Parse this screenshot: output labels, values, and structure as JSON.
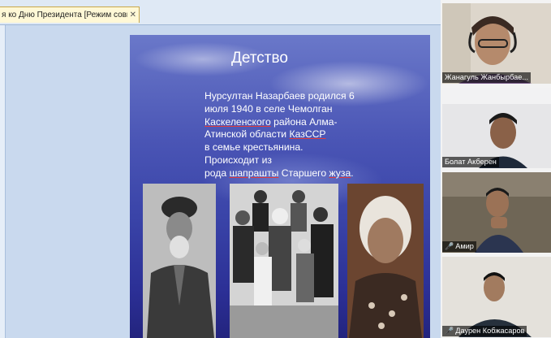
{
  "editor": {
    "doc_tab_title": "я ко Дню Президента [Режим совместимости]",
    "doc_tab_close": "✕"
  },
  "slide": {
    "title": "Детство",
    "body": {
      "line1": "Нурсултан Назарбаев родился 6",
      "line2": "июля 1940 в селе Чемолган",
      "line3a": "Каскеленского",
      "line3b": " района Алма-",
      "line4a": "Атинской области ",
      "line4b": "КазССР",
      "line5": "в семье крестьянина. Происходит из",
      "line6a": "рода ",
      "line6b": "шапрашты",
      "line6c": " Старшего ",
      "line6d": "жуза",
      "line6e": "."
    }
  },
  "participants": [
    {
      "name": "Жанагуль Жанбырбае...",
      "muted": false
    },
    {
      "name": "Болат Акберен",
      "muted": false
    },
    {
      "name": "Амир",
      "muted": true,
      "mute_icon": "🎤"
    },
    {
      "name": "Даурен Кобжасаров",
      "muted": true,
      "mute_icon": "🎤"
    }
  ]
}
